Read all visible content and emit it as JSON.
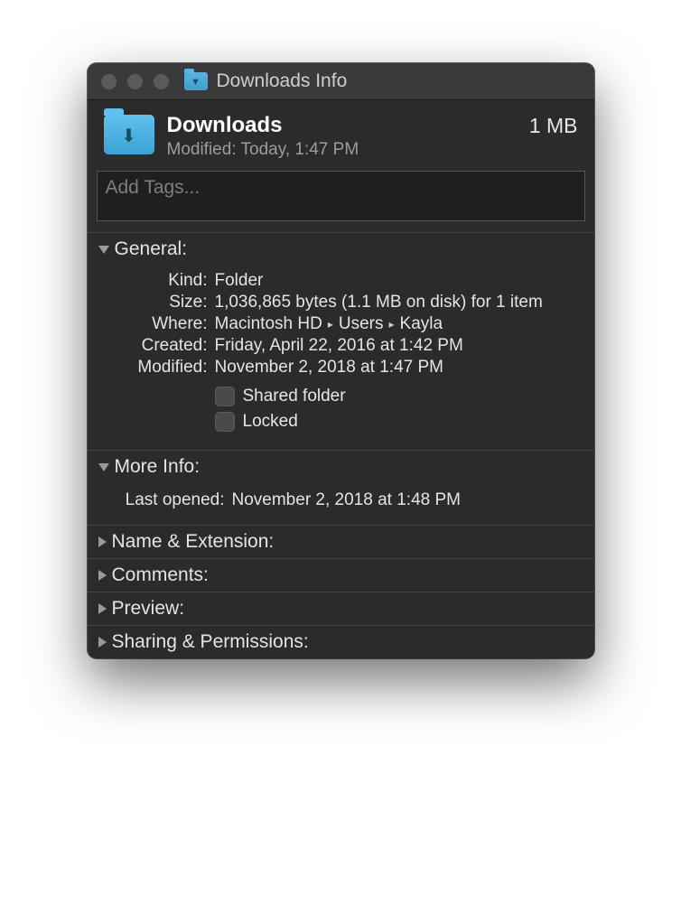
{
  "window": {
    "title": "Downloads Info"
  },
  "header": {
    "name": "Downloads",
    "modified_label": "Modified:",
    "modified_value": "Today, 1:47 PM",
    "size": "1 MB"
  },
  "tags": {
    "placeholder": "Add Tags..."
  },
  "sections": {
    "general": {
      "title": "General:",
      "kind_label": "Kind:",
      "kind_value": "Folder",
      "size_label": "Size:",
      "size_value": "1,036,865 bytes (1.1 MB on disk) for 1 item",
      "where_label": "Where:",
      "where_parts": [
        "Macintosh HD",
        "Users",
        "Kayla"
      ],
      "created_label": "Created:",
      "created_value": "Friday, April 22, 2016 at 1:42 PM",
      "modified_label": "Modified:",
      "modified_value": "November 2, 2018 at 1:47 PM",
      "shared_label": "Shared folder",
      "locked_label": "Locked"
    },
    "more_info": {
      "title": "More Info:",
      "last_opened_label": "Last opened:",
      "last_opened_value": "November 2, 2018 at 1:48 PM"
    },
    "name_ext": {
      "title": "Name & Extension:"
    },
    "comments": {
      "title": "Comments:"
    },
    "preview": {
      "title": "Preview:"
    },
    "sharing": {
      "title": "Sharing & Permissions:"
    }
  }
}
